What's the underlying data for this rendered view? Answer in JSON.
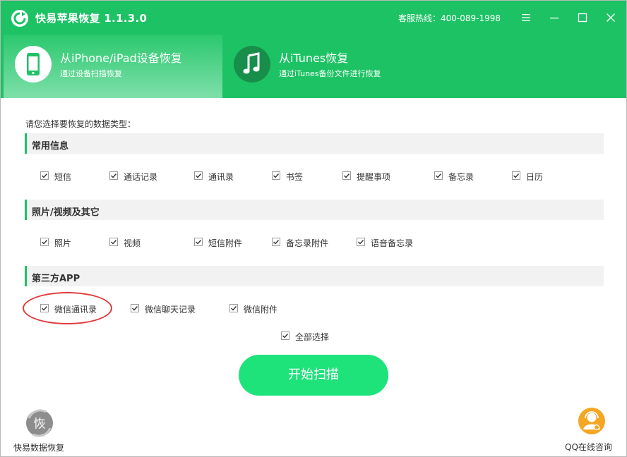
{
  "app": {
    "title": "快易苹果恢复 1.1.3.0",
    "hotline": "客服热线：400-089-1998"
  },
  "colors": {
    "brand_green": "#1dc264",
    "button_green": "#1ee27a",
    "highlight_red": "#e03a3a"
  },
  "modes": [
    {
      "title": "从iPhone/iPad设备恢复",
      "subtitle": "通过设备扫描恢复",
      "icon": "phone-icon",
      "active": true
    },
    {
      "title": "从iTunes恢复",
      "subtitle": "通过iTunes备份文件进行恢复",
      "icon": "music-note-icon",
      "active": false
    }
  ],
  "prompt": "请您选择要恢复的数据类型：",
  "sections": [
    {
      "title": "常用信息",
      "options": [
        {
          "label": "短信",
          "checked": true
        },
        {
          "label": "通话记录",
          "checked": true
        },
        {
          "label": "通讯录",
          "checked": true
        },
        {
          "label": "书签",
          "checked": true
        },
        {
          "label": "提醒事项",
          "checked": true
        },
        {
          "label": "备忘录",
          "checked": true
        },
        {
          "label": "日历",
          "checked": true
        }
      ]
    },
    {
      "title": "照片/视频及其它",
      "options": [
        {
          "label": "照片",
          "checked": true
        },
        {
          "label": "视频",
          "checked": true
        },
        {
          "label": "短信附件",
          "checked": true
        },
        {
          "label": "备忘录附件",
          "checked": true
        },
        {
          "label": "语音备忘录",
          "checked": true
        }
      ]
    },
    {
      "title": "第三方APP",
      "options": [
        {
          "label": "微信通讯录",
          "checked": true
        },
        {
          "label": "微信聊天记录",
          "checked": true
        },
        {
          "label": "微信附件",
          "checked": true
        }
      ]
    }
  ],
  "select_all": {
    "label": "全部选择",
    "checked": true
  },
  "start_button": "开始扫描",
  "footer": {
    "left_label": "快易数据恢复",
    "left_icon_char": "恢",
    "right_label": "QQ在线咨询"
  }
}
